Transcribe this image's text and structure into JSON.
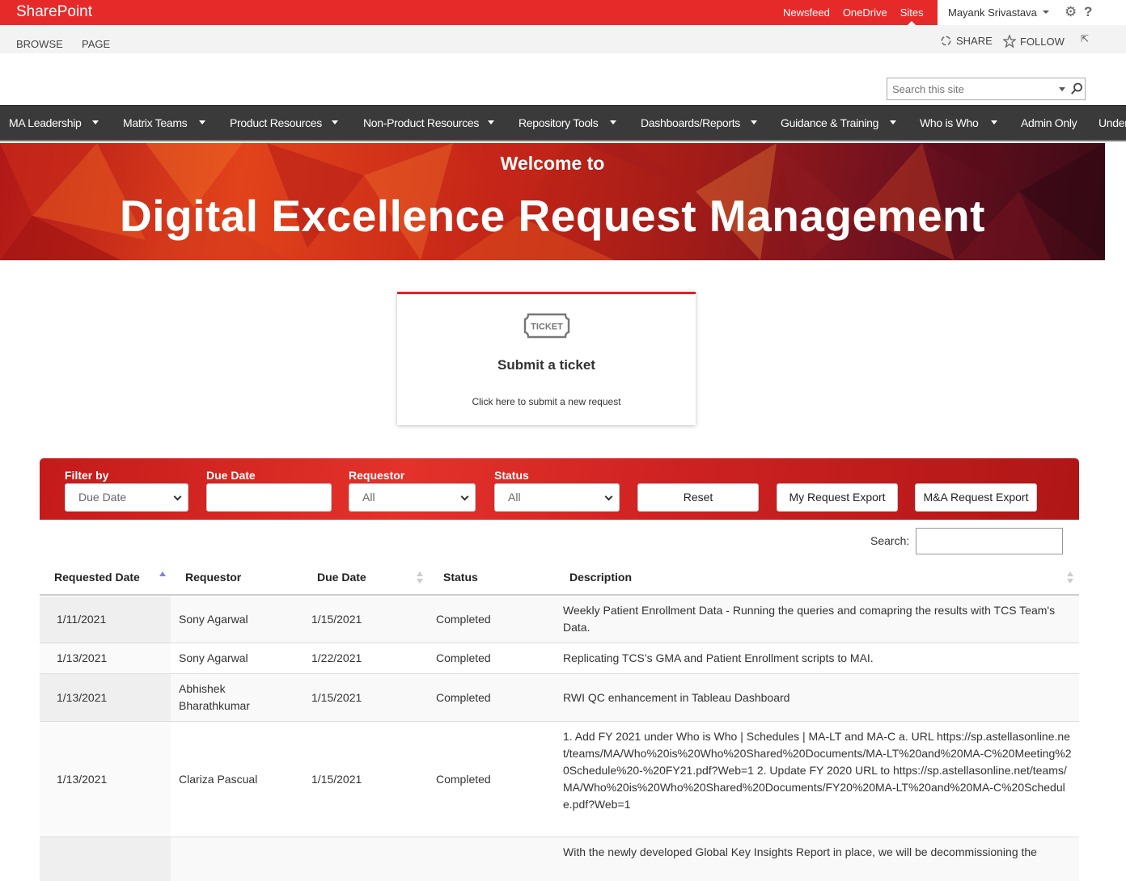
{
  "suitebar": {
    "brand": "SharePoint",
    "links": [
      "Newsfeed",
      "OneDrive",
      "Sites"
    ],
    "user": "Mayank Srivastava"
  },
  "ribbon": {
    "tabs": [
      "BROWSE",
      "PAGE"
    ],
    "share": "SHARE",
    "follow": "FOLLOW"
  },
  "search": {
    "placeholder": "Search this site"
  },
  "topnav": {
    "items": [
      "MA Leadership",
      "Matrix Teams",
      "Product Resources",
      "Non-Product Resources",
      "Repository Tools",
      "Dashboards/Reports",
      "Guidance & Training",
      "Who is Who",
      "Admin Only",
      "Under"
    ]
  },
  "banner": {
    "welcome": "Welcome to",
    "title": "Digital Excellence Request Management"
  },
  "card": {
    "icon_text": "TICKET",
    "title": "Submit a ticket",
    "subtitle": "Click here to submit a new request"
  },
  "filters": {
    "filter_by_label": "Filter by",
    "filter_by_value": "Due Date",
    "due_date_label": "Due Date",
    "requestor_label": "Requestor",
    "requestor_value": "All",
    "status_label": "Status",
    "status_value": "All",
    "reset": "Reset",
    "my_export": "My Request Export",
    "ma_export": "M&A Request Export"
  },
  "table": {
    "search_label": "Search:",
    "columns": [
      "Requested Date",
      "Requestor",
      "Due Date",
      "Status",
      "Description"
    ],
    "rows": [
      {
        "requested": "1/11/2021",
        "requestor": "Sony Agarwal",
        "due": "1/15/2021",
        "status": "Completed",
        "description": "Weekly Patient Enrollment Data - Running the queries and comapring the results with TCS Team's Data."
      },
      {
        "requested": "1/13/2021",
        "requestor": "Sony Agarwal",
        "due": "1/22/2021",
        "status": "Completed",
        "description": "Replicating TCS's GMA and Patient Enrollment scripts to MAI."
      },
      {
        "requested": "1/13/2021",
        "requestor": "Abhishek Bharathkumar",
        "due": "1/15/2021",
        "status": "Completed",
        "description": "RWI QC enhancement in Tableau Dashboard"
      },
      {
        "requested": "1/13/2021",
        "requestor": "Clariza Pascual",
        "due": "1/15/2021",
        "status": "Completed",
        "description": "1. Add FY 2021 under Who is Who | Schedules | MA-LT and MA-C a. URL https://sp.astellasonline.net/teams/MA/Who%20is%20Who%20Shared%20Documents/MA-LT%20and%20MA-C%20Meeting%20Schedule%20-%20FY21.pdf?Web=1 2. Update FY 2020 URL to https://sp.astellasonline.net/teams/MA/Who%20is%20Who%20Shared%20Documents/FY20%20MA-LT%20and%20MA-C%20Schedule.pdf?Web=1"
      },
      {
        "requested": "",
        "requestor": "",
        "due": "",
        "status": "",
        "description": "With the newly developed Global Key Insights Report in place, we will be decommissioning the"
      }
    ]
  },
  "colors": {
    "suitebar": "#e62a2a",
    "accent": "#e21f2b",
    "nav": "#3a3a3a"
  }
}
